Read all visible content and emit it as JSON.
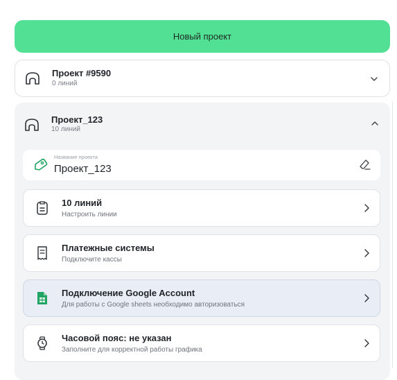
{
  "new_project_button": "Новый проект",
  "projects": [
    {
      "title": "Проект #9590",
      "lines": "0 линий",
      "expanded": false
    },
    {
      "title": "Проект_123",
      "lines": "10 линий",
      "expanded": true
    }
  ],
  "project_name_field": {
    "label": "Название проекта",
    "value": "Проект_123"
  },
  "settings_rows": [
    {
      "title": "10 линий",
      "subtitle": "Настроить линии",
      "icon": "clipboard-icon"
    },
    {
      "title": "Платежные системы",
      "subtitle": "Подключите кассы",
      "icon": "receipt-icon"
    },
    {
      "title": "Подключение Google Account",
      "subtitle": "Для работы с Google sheets необходимо авторизоваться",
      "icon": "google-sheets-icon"
    },
    {
      "title": "Часовой пояс: не указан",
      "subtitle": "Заполните для корректной работы графика",
      "icon": "watch-icon"
    }
  ],
  "colors": {
    "accent": "#52e095",
    "sheets_green": "#1fa463",
    "highlight_row": "#e9eef6"
  }
}
